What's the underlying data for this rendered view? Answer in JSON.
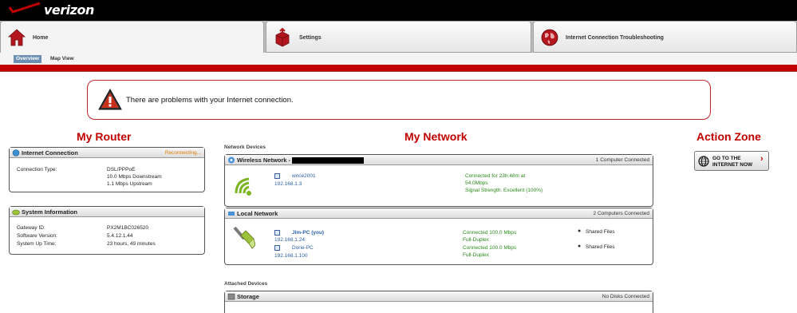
{
  "brand": {
    "logo_text": "verizon"
  },
  "nav": {
    "tabs": [
      {
        "label": "Home",
        "icon": "home-icon"
      },
      {
        "label": "Settings",
        "icon": "settings-box-icon"
      },
      {
        "label": "Internet Connection Troubleshooting",
        "icon": "globe-icon"
      }
    ],
    "subtabs": [
      {
        "label": "Overview",
        "active": true
      },
      {
        "label": "Map View",
        "active": false
      }
    ]
  },
  "alert": {
    "message": "There are problems with your Internet connection.",
    "icon": "warning-icon"
  },
  "sections": {
    "router": "My Router",
    "network": "My Network",
    "action": "Action Zone"
  },
  "internet_connection": {
    "title": "Internet Connection",
    "status": "Reconnecting...",
    "type_label": "Connection Type:",
    "type_value": "DSL/PPPoE",
    "downstream": "10.0 Mbps Downstream",
    "upstream": "1.1 Mbps Upstream"
  },
  "system_info": {
    "title": "System Information",
    "rows": [
      {
        "label": "Gateway ID:",
        "value": "PX2M1BC026520"
      },
      {
        "label": "Software Version:",
        "value": "5.4.12.1.44"
      },
      {
        "label": "System Up Time:",
        "value": "23 hours, 49 minutes"
      }
    ]
  },
  "network": {
    "devices_label": "Network Devices",
    "wireless": {
      "title": "Wireless Network -",
      "count": "1 Computer Connected",
      "device_name": "wnce2001",
      "device_ip": "192.168.1.3",
      "status_line1": "Connected for 23h:48m at",
      "status_line2": "54.0Mbps",
      "status_line3": "Signal Strength: Excellent (100%)"
    },
    "local": {
      "title": "Local Network",
      "count": "2 Computers Connected",
      "devices": [
        {
          "name": "Jim-PC (you)",
          "ip": "192.168.1.24",
          "status1": "Connected 100.0 Mbps",
          "status2": "Full-Duplex",
          "share": "Shared Files"
        },
        {
          "name": "Dorie-PC",
          "ip": "192.168.1.100",
          "status1": "Connected 100.0 Mbps",
          "status2": "Full-Duplex",
          "share": "Shared Files"
        }
      ]
    },
    "attached_label": "Attached Devices",
    "storage": {
      "title": "Storage",
      "status": "No Disks Connected"
    }
  },
  "action_zone": {
    "button_line1": "GO TO THE",
    "button_line2": "INTERNET NOW",
    "icon": "globe-icon"
  },
  "colors": {
    "accent_red": "#c00000",
    "link_blue": "#2a5fa8",
    "status_green": "#2a8a1a",
    "status_orange": "#e07a00"
  }
}
